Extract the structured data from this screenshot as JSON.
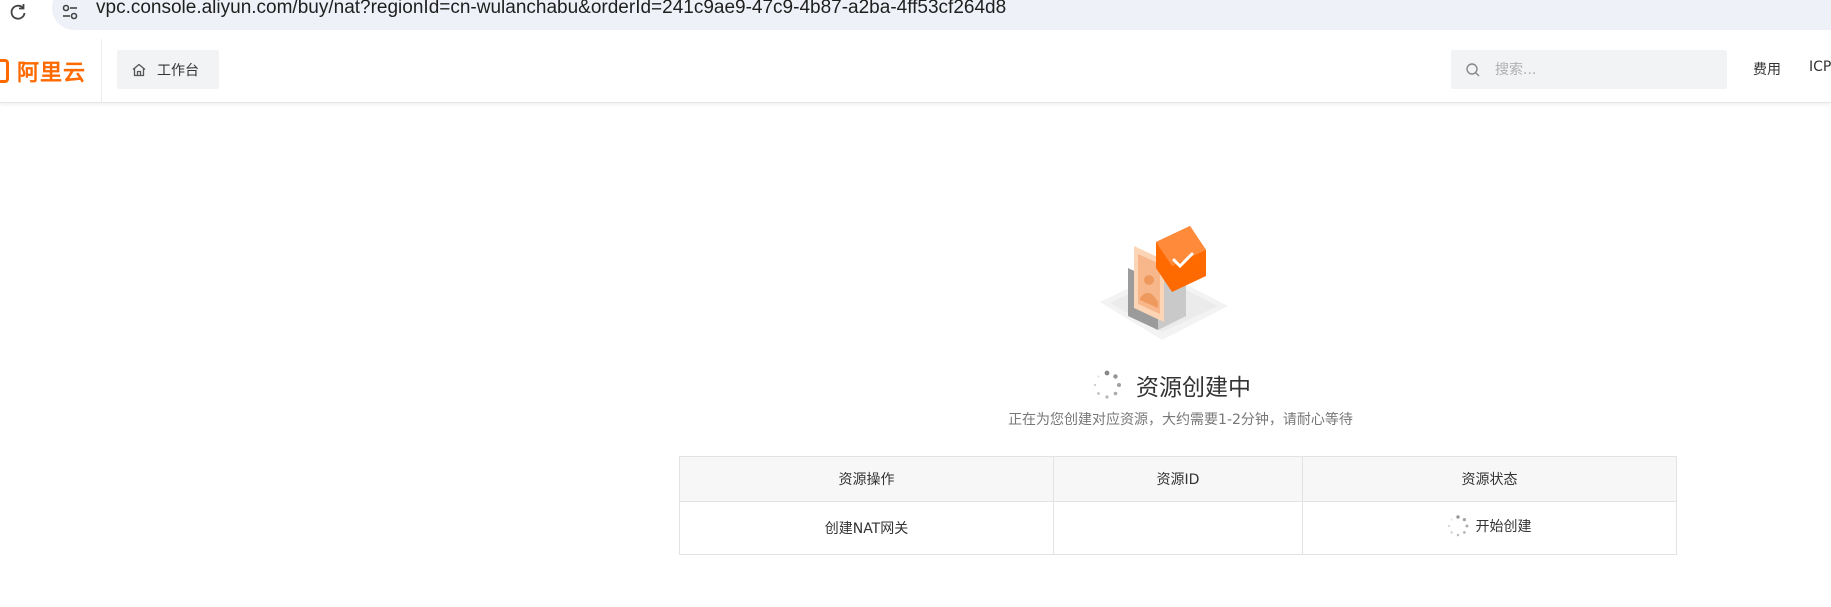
{
  "browser": {
    "url": "vpc.console.aliyun.com/buy/nat?regionId=cn-wulanchabu&orderId=241c9ae9-47c9-4b87-a2ba-4ff53cf264d8"
  },
  "header": {
    "logo_text": "阿里云",
    "workbench_label": "工作台",
    "search_placeholder": "搜索...",
    "nav_fee": "费用",
    "nav_icp": "ICP"
  },
  "status": {
    "title": "资源创建中",
    "subtitle": "正在为您创建对应资源，大约需要1-2分钟，请耐心等待"
  },
  "table": {
    "headers": [
      "资源操作",
      "资源ID",
      "资源状态"
    ],
    "rows": [
      {
        "operation": "创建NAT网关",
        "resource_id": "",
        "status": "开始创建"
      }
    ]
  },
  "colors": {
    "brand": "#ff6a00"
  }
}
